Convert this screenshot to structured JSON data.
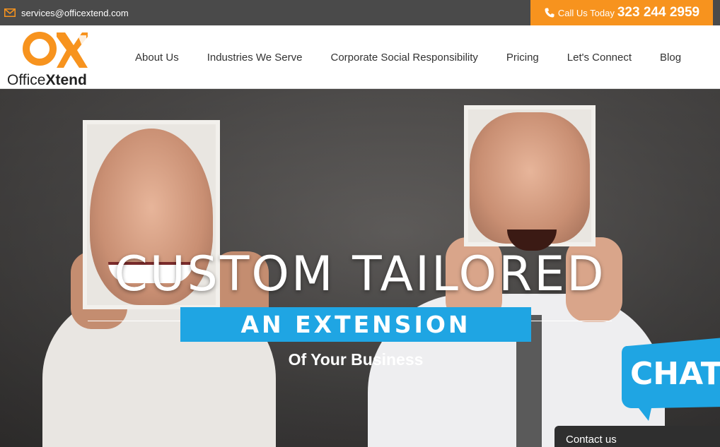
{
  "topbar": {
    "email": "services@officextend.com",
    "call_label": "Call Us Today",
    "call_number": "323 244 2959",
    "colors": {
      "bar": "#4a4a4a",
      "call_bg": "#f7931e"
    },
    "icons": {
      "email": "mail-icon",
      "phone": "phone-icon"
    }
  },
  "logo": {
    "text_regular": "Office",
    "text_bold": "Xtend",
    "accent": "#f7931e"
  },
  "nav": {
    "items": [
      {
        "label": "About Us"
      },
      {
        "label": "Industries We Serve"
      },
      {
        "label": "Corporate Social Responsibility"
      },
      {
        "label": "Pricing"
      },
      {
        "label": "Let's Connect"
      },
      {
        "label": "Blog"
      }
    ]
  },
  "hero": {
    "headline": "CUSTOM TAILORED",
    "tagline": "AN EXTENSION",
    "subheading": "Of Your Business",
    "tagline_color": "#1fa5e3"
  },
  "chat": {
    "label": "CHAT",
    "color": "#1fa5e3"
  },
  "contact": {
    "label": "Contact us"
  }
}
